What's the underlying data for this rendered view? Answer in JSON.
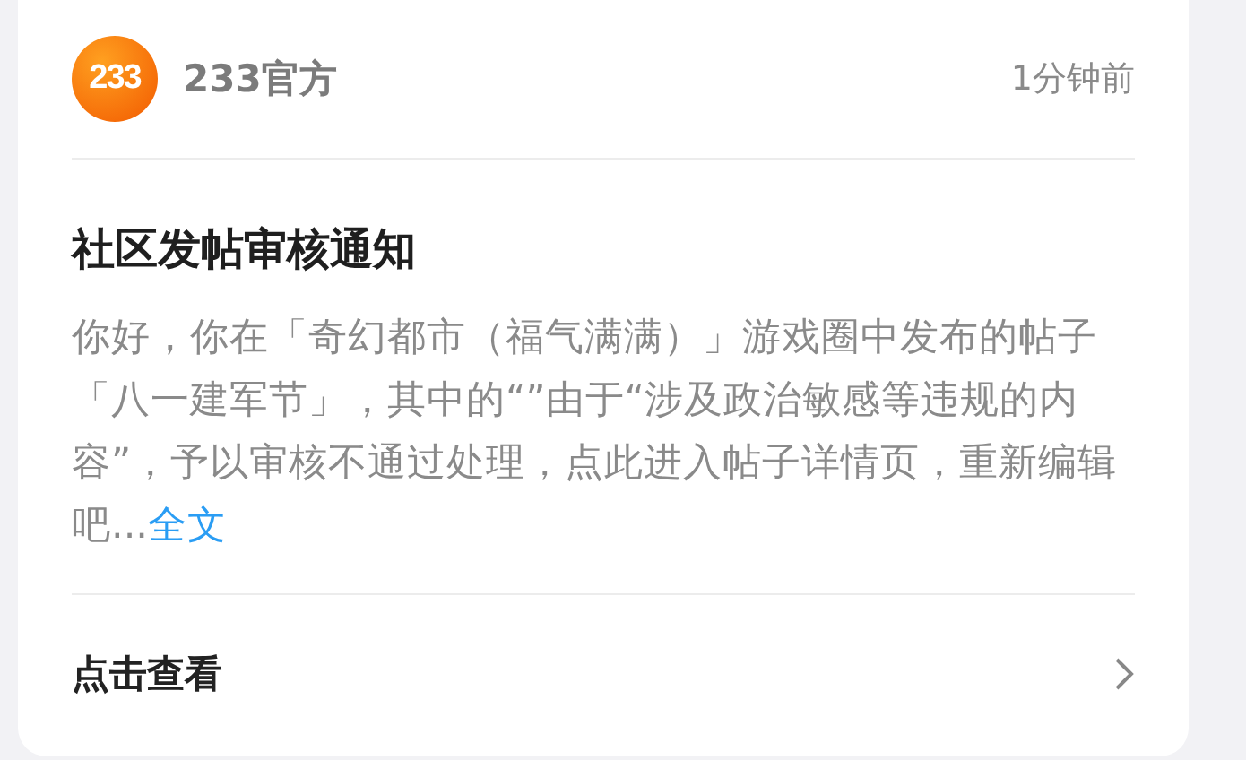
{
  "header": {
    "logo": "233",
    "sender": "233官方",
    "time": "1分钟前"
  },
  "title": "社区发帖审核通知",
  "body": {
    "text": "你好，你在「奇幻都市（福气满满）」游戏圈中发布的帖子「八一建军节」，其中的“”由于“涉及政治敏感等违规的内容”，予以审核不通过处理，点此进入帖子详情页，重新编辑吧...",
    "link": "全文"
  },
  "action": {
    "label": "点击查看"
  }
}
